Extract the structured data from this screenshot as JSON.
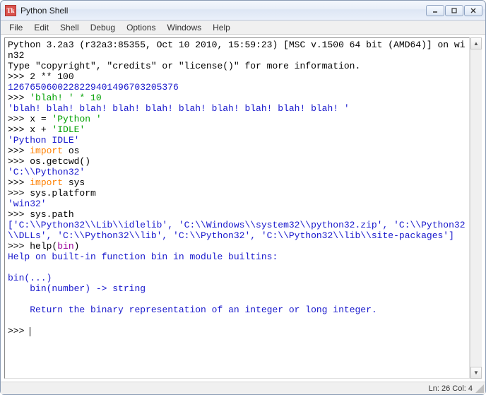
{
  "window": {
    "title": "Python Shell",
    "icon_label": "Tk"
  },
  "menu": [
    "File",
    "Edit",
    "Shell",
    "Debug",
    "Options",
    "Windows",
    "Help"
  ],
  "status": {
    "line": 26,
    "col": 4,
    "text": "Ln: 26 Col: 4"
  },
  "shell": {
    "banner1": "Python 3.2a3 (r32a3:85355, Oct 10 2010, 15:59:23) [MSC v.1500 64 bit (AMD64)] on win32",
    "banner2": "Type \"copyright\", \"credits\" or \"license()\" for more information.",
    "p": ">>> ",
    "in1_num": "2 ** 100",
    "out1": "1267650600228229401496703205376",
    "in2_str": "'blah! ' * 10",
    "out2": "'blah! blah! blah! blah! blah! blah! blah! blah! blah! blah! '",
    "in3_pre": "x = ",
    "in3_str": "'Python '",
    "in4_pre": "x + ",
    "in4_str": "'IDLE'",
    "out4": "'Python IDLE'",
    "in5_kw": "import",
    "in5_rest": " os",
    "in6": "os.getcwd()",
    "out6": "'C:\\\\Python32'",
    "in7_kw": "import",
    "in7_rest": " sys",
    "in8": "sys.platform",
    "out8": "'win32'",
    "in9": "sys.path",
    "out9": "['C:\\\\Python32\\\\Lib\\\\idlelib', 'C:\\\\Windows\\\\system32\\\\python32.zip', 'C:\\\\Python32\\\\DLLs', 'C:\\\\Python32\\\\lib', 'C:\\\\Python32', 'C:\\\\Python32\\\\lib\\\\site-packages']",
    "in10_pre": "help(",
    "in10_builtin": "bin",
    "in10_post": ")",
    "help1": "Help on built-in function bin in module builtins:",
    "help2": "bin(...)",
    "help3": "    bin(number) -> string",
    "help4": "    Return the binary representation of an integer or long integer."
  }
}
